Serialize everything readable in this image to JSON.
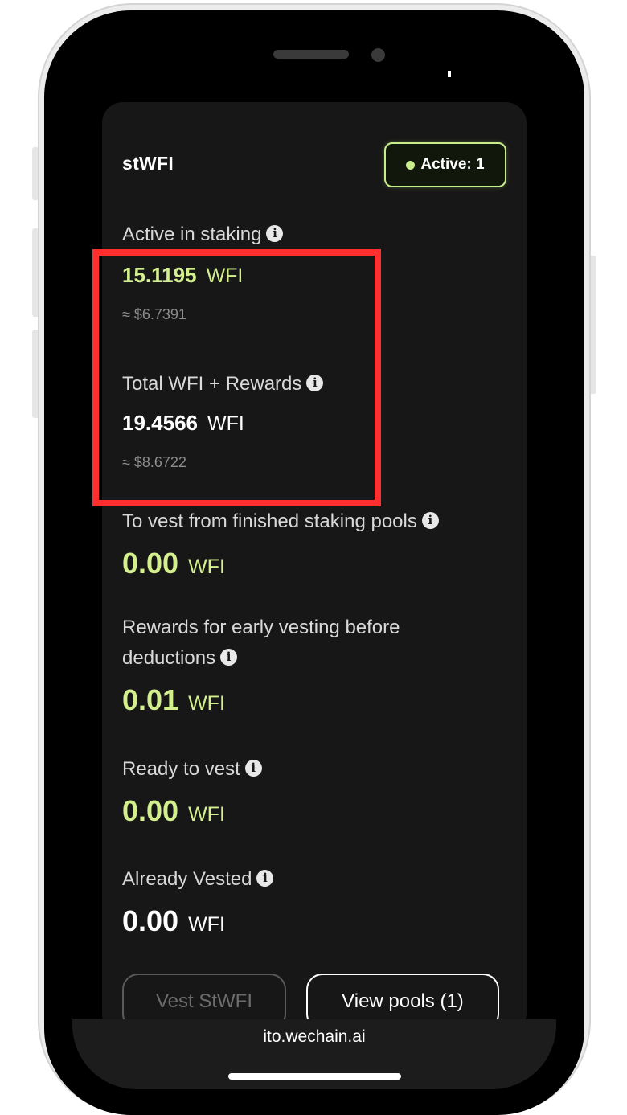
{
  "browser": {
    "url": "ito.wechain.ai"
  },
  "card": {
    "title": "stWFI",
    "badge": {
      "label": "Active: 1",
      "dot_color": "#c8ee8c"
    }
  },
  "sections": {
    "active_in_staking": {
      "label": "Active in staking",
      "value": "15.1195",
      "unit": "WFI",
      "usd": "≈ $6.7391"
    },
    "total_rewards": {
      "label": "Total WFI + Rewards",
      "value": "19.4566",
      "unit": "WFI",
      "usd": "≈ $8.6722"
    },
    "to_vest": {
      "label": "To vest from finished staking pools",
      "value": "0.00",
      "unit": "WFI"
    },
    "early_vesting": {
      "label_line1": "Rewards for early vesting before",
      "label_line2": "deductions",
      "value": "0.01",
      "unit": "WFI"
    },
    "ready_to_vest": {
      "label": "Ready to vest",
      "value": "0.00",
      "unit": "WFI"
    },
    "already_vested": {
      "label": "Already Vested",
      "value": "0.00",
      "unit": "WFI"
    }
  },
  "buttons": {
    "vest": "Vest StWFI",
    "view_pools": "View pools (1)"
  },
  "icons": {
    "info": "info-icon",
    "info_glyph": "i"
  },
  "colors": {
    "accent_green": "#d4f08e",
    "highlight_red": "#ff2f2f",
    "card_bg": "#171717"
  }
}
